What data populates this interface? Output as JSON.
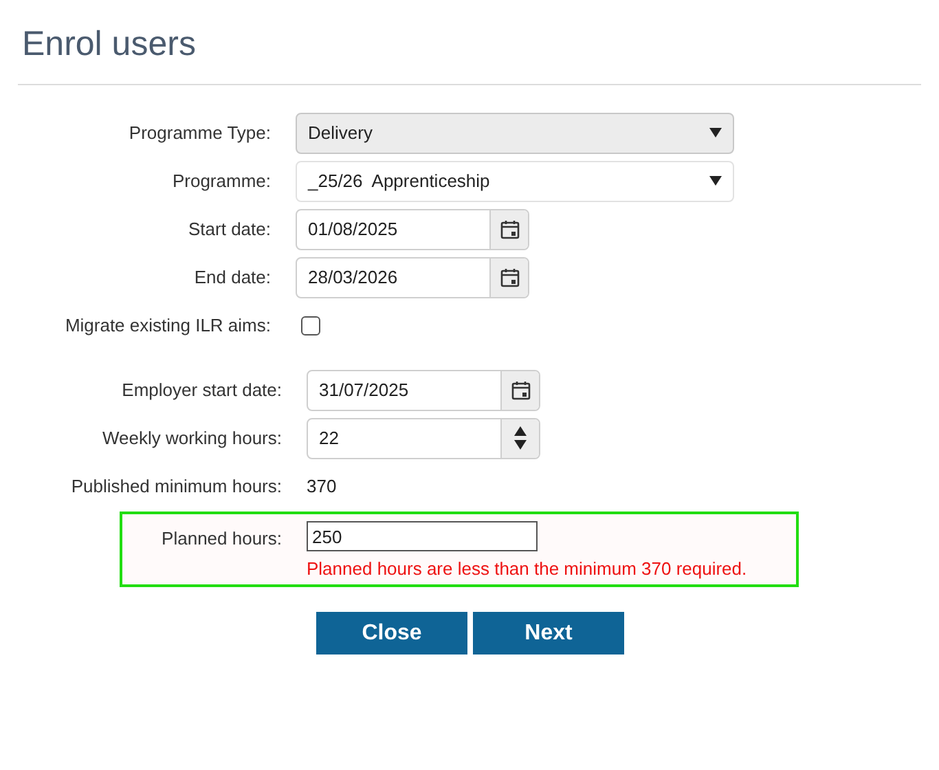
{
  "title": "Enrol users",
  "fields": [
    {
      "kind": "select",
      "label": "Programme Type:",
      "value": "Delivery",
      "disabled": true
    },
    {
      "kind": "select",
      "label": "Programme:",
      "value": "_25/26  Apprenticeship",
      "disabled": false
    },
    {
      "kind": "date",
      "label": "Start date:",
      "value": "01/08/2025"
    },
    {
      "kind": "date",
      "label": "End date:",
      "value": "28/03/2026"
    },
    {
      "kind": "checkbox",
      "label": "Migrate existing ILR aims:",
      "checked": false
    }
  ],
  "employment_fields": [
    {
      "kind": "date",
      "label": "Employer start date:",
      "value": "31/07/2025"
    },
    {
      "kind": "number",
      "label": "Weekly working hours:",
      "value": "22"
    },
    {
      "kind": "text",
      "label": "Published minimum hours:",
      "value": "370"
    }
  ],
  "planned": {
    "label": "Planned hours:",
    "value": "250",
    "error": "Planned hours are less than the minimum 370 required."
  },
  "buttons": [
    "Close",
    "Next"
  ]
}
